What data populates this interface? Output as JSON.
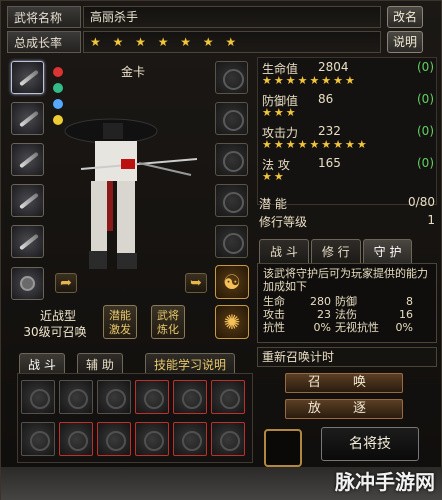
{
  "header": {
    "name_label": "武将名称",
    "name_value": "高丽杀手",
    "rename_button": "改名",
    "growth_label": "总成长率",
    "growth_stars": "★ ★ ★ ★ ★ ★ ★",
    "info_button": "说明"
  },
  "portrait": {
    "card_label": "金卡",
    "attack_type": "近战型",
    "summon_level": "30级可召唤",
    "potential_button": "潜能激发",
    "refine_button": "武将炼化"
  },
  "stats": [
    {
      "name": "生命值",
      "value": "2804",
      "bonus": "(0)",
      "stars": "★★★★★★★★"
    },
    {
      "name": "防御值",
      "value": "86",
      "bonus": "(0)",
      "stars": "★★★"
    },
    {
      "name": "攻击力",
      "value": "232",
      "bonus": "(0)",
      "stars": "★★★★★★★★★"
    },
    {
      "name": "法  攻",
      "value": "165",
      "bonus": "(0)",
      "stars": "★★"
    }
  ],
  "misc": {
    "potential_label": "潜  能",
    "potential_value": "0/80",
    "cultivation_label": "修行等级",
    "cultivation_value": "1"
  },
  "tabs": [
    "战 斗",
    "修 行",
    "守 护"
  ],
  "guard": {
    "description": "该武将守护后可为玩家提供的能力加成如下",
    "rows": [
      [
        "生命",
        "280",
        "防御",
        "8"
      ],
      [
        "攻击",
        "23",
        "法伤",
        "16"
      ],
      [
        "抗性",
        "0%",
        "无视抗性",
        "0%"
      ]
    ]
  },
  "bottom": {
    "tab_battle": "战 斗",
    "tab_assist": "辅 助",
    "skill_help": "技能学习说明",
    "timer_label": "重新召唤计时",
    "summon_button": "召 唤",
    "dismiss_button": "放 逐",
    "famous_skill_button": "名将技"
  },
  "watermark": "脉冲手游网",
  "colors": {
    "accent_gold": "#f2c53a",
    "bonus_green": "#62d05f",
    "slot_red": "#c0302a"
  }
}
